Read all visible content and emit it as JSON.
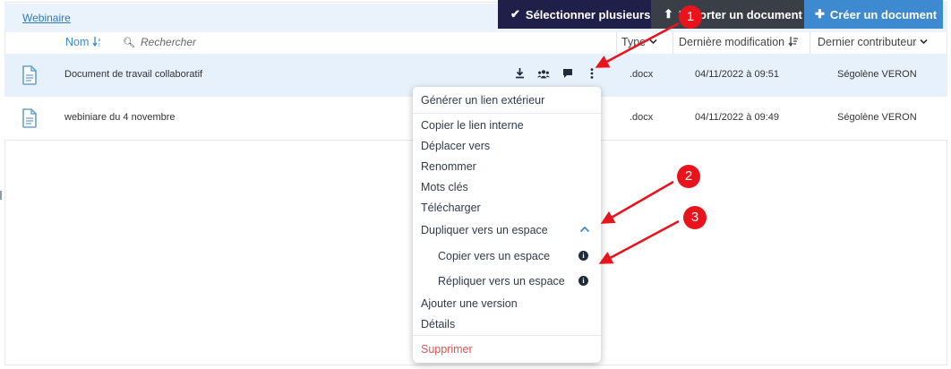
{
  "breadcrumb": "Webinaire",
  "toolbar": {
    "select_multiple": "Sélectionner plusieurs",
    "upload_document": "Importer un document",
    "create_document": "Créer un document"
  },
  "columns": {
    "name": "Nom",
    "search_placeholder": "Rechercher",
    "type": "Type",
    "last_modified": "Dernière modification",
    "last_contributor": "Dernier contributeur"
  },
  "rows": [
    {
      "name": "Document de travail collaboratif",
      "ext": ".docx",
      "date": "04/11/2022 à 09:51",
      "author": "Ségolène VERON"
    },
    {
      "name": "webiniare du 4 novembre",
      "ext": ".docx",
      "date": "04/11/2022 à 09:49",
      "author": "Ségolène VERON"
    }
  ],
  "menu": {
    "external_link": "Générer un lien extérieur",
    "copy_internal": "Copier le lien interne",
    "move_to": "Déplacer vers",
    "rename": "Renommer",
    "keywords": "Mots clés",
    "download": "Télécharger",
    "duplicate": "Dupliquer vers un espace",
    "copy_space": "Copier vers un espace",
    "replicate_space": "Répliquer vers un espace",
    "add_version": "Ajouter une version",
    "details": "Détails",
    "delete": "Supprimer"
  },
  "annotations": [
    "1",
    "2",
    "3"
  ],
  "colors": {
    "accent": "#3d8ad0",
    "dark": "#1f1f4a",
    "annotation": "#e8131b",
    "danger": "#e55353"
  }
}
